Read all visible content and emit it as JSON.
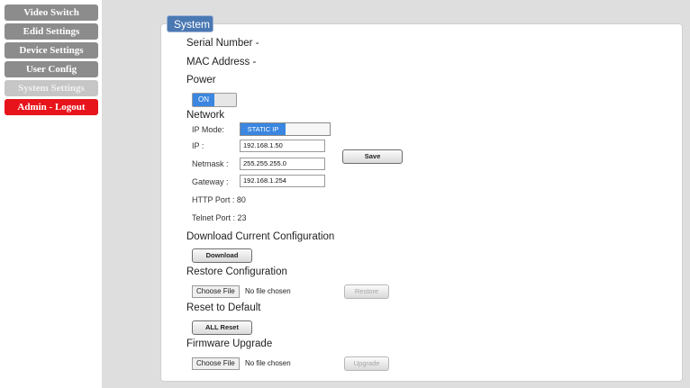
{
  "sidebar": {
    "items": [
      {
        "label": "Video Switch"
      },
      {
        "label": "Edid Settings"
      },
      {
        "label": "Device Settings"
      },
      {
        "label": "User Config"
      },
      {
        "label": "System Settings"
      },
      {
        "label": "Admin - Logout"
      }
    ]
  },
  "panel": {
    "title": "System",
    "serial_number": "Serial Number -",
    "mac_address": "MAC Address -",
    "power_heading": "Power",
    "power_toggle": "ON",
    "network_heading": "Network",
    "ip_mode_label": "IP Mode:",
    "ip_mode_value": "STATIC IP",
    "ip_label": "IP :",
    "ip_value": "192.168.1.50",
    "netmask_label": "Netmask :",
    "netmask_value": "255.255.255.0",
    "gateway_label": "Gateway :",
    "gateway_value": "192.168.1.254",
    "save_label": "Save",
    "http_port": "HTTP Port : 80",
    "telnet_port": "Telnet Port : 23",
    "download_heading": "Download Current Configuration",
    "download_label": "Download",
    "restore_heading": "Restore Configuration",
    "choose_file_label": "Choose File",
    "no_file_label": "No file chosen",
    "restore_label": "Restore",
    "reset_heading": "Reset to Default",
    "all_reset_label": "ALL Reset",
    "firmware_heading": "Firmware Upgrade",
    "upgrade_label": "Upgrade"
  }
}
